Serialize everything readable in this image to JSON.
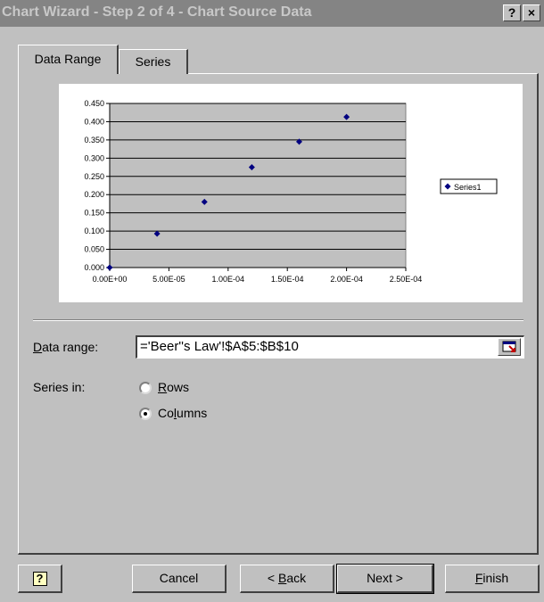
{
  "titlebar": {
    "title": "Chart Wizard - Step 2 of 4 - Chart Source Data",
    "help_label": "?",
    "close_label": "×"
  },
  "tabs": [
    {
      "label": "Data Range",
      "active": true
    },
    {
      "label": "Series",
      "active": false
    }
  ],
  "chart_data": {
    "type": "scatter",
    "x": [
      0,
      4e-05,
      8e-05,
      0.00012,
      0.00016,
      0.0002
    ],
    "y": [
      0,
      0.093,
      0.18,
      0.275,
      0.345,
      0.413
    ],
    "xlim": [
      0,
      0.00025
    ],
    "ylim": [
      0,
      0.45
    ],
    "x_ticks": [
      "0.00E+00",
      "5.00E-05",
      "1.00E-04",
      "1.50E-04",
      "2.00E-04",
      "2.50E-04"
    ],
    "y_ticks": [
      "0.000",
      "0.050",
      "0.100",
      "0.150",
      "0.200",
      "0.250",
      "0.300",
      "0.350",
      "0.400",
      "0.450"
    ],
    "series": [
      {
        "name": "Series1",
        "color": "#000080"
      }
    ],
    "legend": "right",
    "grid": true
  },
  "data_range": {
    "label_prefix": "D",
    "label_rest": "ata range:",
    "value": "='Beer''s Law'!$A$5:$B$10"
  },
  "series_in": {
    "label": "Series in:",
    "options": [
      {
        "prefix": "",
        "underline": "R",
        "rest": "ows",
        "selected": false
      },
      {
        "prefix": "Co",
        "underline": "l",
        "rest": "umns",
        "selected": true
      }
    ]
  },
  "buttons": {
    "help_icon": "?",
    "cancel": "Cancel",
    "back_prefix": "< ",
    "back_underline": "B",
    "back_rest": "ack",
    "next": "Next >",
    "finish_underline": "F",
    "finish_rest": "inish"
  }
}
